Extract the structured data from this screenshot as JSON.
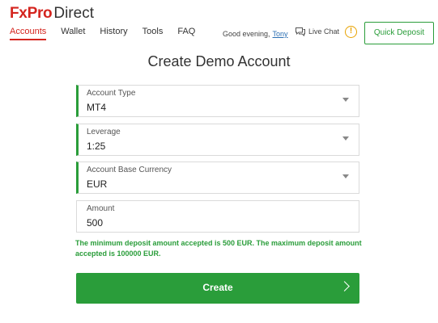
{
  "header": {
    "logo_brand": "FxPro",
    "logo_suffix": "Direct",
    "nav": [
      {
        "label": "Accounts",
        "active": true
      },
      {
        "label": "Wallet",
        "active": false
      },
      {
        "label": "History",
        "active": false
      },
      {
        "label": "Tools",
        "active": false
      },
      {
        "label": "FAQ",
        "active": false
      }
    ],
    "greeting": "Good evening,",
    "username": "Tony",
    "live_chat": "Live Chat",
    "alert_glyph": "!",
    "quick_deposit": "Quick Deposit"
  },
  "main": {
    "title": "Create Demo Account",
    "fields": {
      "account_type": {
        "label": "Account Type",
        "value": "MT4"
      },
      "leverage": {
        "label": "Leverage",
        "value": "1:25"
      },
      "currency": {
        "label": "Account Base Currency",
        "value": "EUR"
      },
      "amount": {
        "label": "Amount",
        "value": "500"
      }
    },
    "notice": "The minimum deposit amount accepted is 500 EUR. The maximum deposit amount accepted is 100000 EUR.",
    "create_label": "Create"
  },
  "colors": {
    "brand_red": "#d4251f",
    "accent_green": "#2a9d3a",
    "link_blue": "#2b6fb3",
    "alert_amber": "#e8a200"
  },
  "icons": [
    "chat-bubble-icon",
    "alert-icon",
    "chevron-down-icon",
    "chevron-right-icon"
  ]
}
